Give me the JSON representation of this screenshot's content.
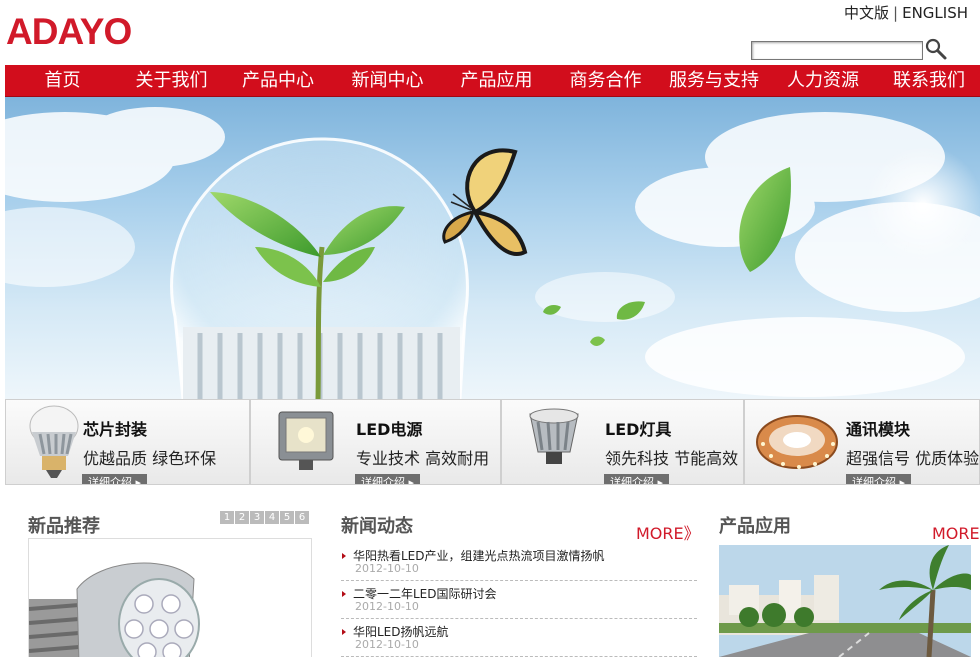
{
  "header": {
    "logo_text": "ADAYO",
    "lang_cn": "中文版",
    "lang_sep": "|",
    "lang_en": "ENGLISH",
    "search_placeholder": ""
  },
  "nav": {
    "items": [
      "首页",
      "关于我们",
      "产品中心",
      "新闻中心",
      "产品应用",
      "商务合作",
      "服务与支持",
      "人力资源",
      "联系我们"
    ]
  },
  "categories": [
    {
      "title": "芯片封装",
      "subtitle": "优越品质 绿色环保",
      "more": "详细介绍",
      "icon": "led-bulb-icon"
    },
    {
      "title": "LED电源",
      "subtitle": "专业技术 高效耐用",
      "more": "详细介绍",
      "icon": "floodlight-icon"
    },
    {
      "title": "LED灯具",
      "subtitle": "领先科技 节能高效",
      "more": "详细介绍",
      "icon": "spotlight-icon"
    },
    {
      "title": "通讯模块",
      "subtitle": "超强信号 优质体验",
      "more": "详细介绍",
      "icon": "led-strip-icon"
    }
  ],
  "new_products": {
    "title": "新品推荐",
    "pages": [
      "1",
      "2",
      "3",
      "4",
      "5",
      "6"
    ]
  },
  "news": {
    "title": "新闻动态",
    "more": "MORE》",
    "items": [
      {
        "title": "华阳热看LED产业，组建光点热流项目激情扬帆",
        "date": "2012-10-10"
      },
      {
        "title": "二零一二年LED国际研讨会",
        "date": "2012-10-10"
      },
      {
        "title": "华阳LED扬帆远航",
        "date": "2012-10-10"
      }
    ]
  },
  "applications": {
    "title": "产品应用",
    "more": "MORE》"
  },
  "colors": {
    "brand_red": "#d20d1c",
    "accent_red": "#d11a2a"
  }
}
